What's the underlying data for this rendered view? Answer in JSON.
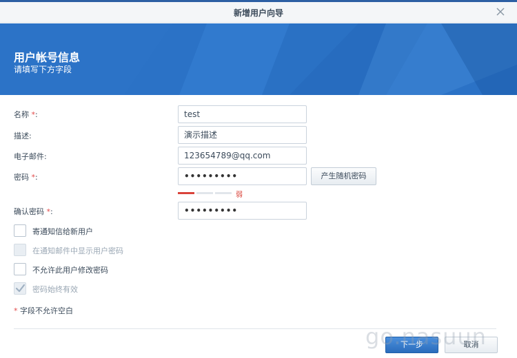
{
  "dialog": {
    "title": "新增用户向导"
  },
  "banner": {
    "title": "用户帐号信息",
    "subtitle": "请填写下方字段"
  },
  "form": {
    "required_mark": "*",
    "name": {
      "label": "名称",
      "colon": ":",
      "value": "test"
    },
    "description": {
      "label": "描述:",
      "value": "演示描述"
    },
    "email": {
      "label": "电子邮件:",
      "value": "123654789@qq.com"
    },
    "password": {
      "label": "密码",
      "colon": ":",
      "value": "•••••••••"
    },
    "generate_password_button": "产生随机密码",
    "password_strength": {
      "label": "弱",
      "level": 0.25,
      "color": "#d9433a"
    },
    "confirm_password": {
      "label": "确认密码",
      "colon": ":",
      "value": "•••••••••"
    }
  },
  "options": [
    {
      "label": "寄通知信给新用户",
      "checked": false,
      "disabled": false
    },
    {
      "label": "在通知邮件中显示用户密码",
      "checked": false,
      "disabled": true
    },
    {
      "label": "不允许此用户修改密码",
      "checked": false,
      "disabled": false
    },
    {
      "label": "密码始终有效",
      "checked": true,
      "disabled": true
    }
  ],
  "note": {
    "mark": "*",
    "text": "字段不允许空白"
  },
  "buttons": {
    "next": "下一步",
    "cancel": "取消"
  },
  "watermark": "go.nasuun",
  "colors": {
    "accent": "#2b72c6",
    "required": "#e24a4a"
  }
}
